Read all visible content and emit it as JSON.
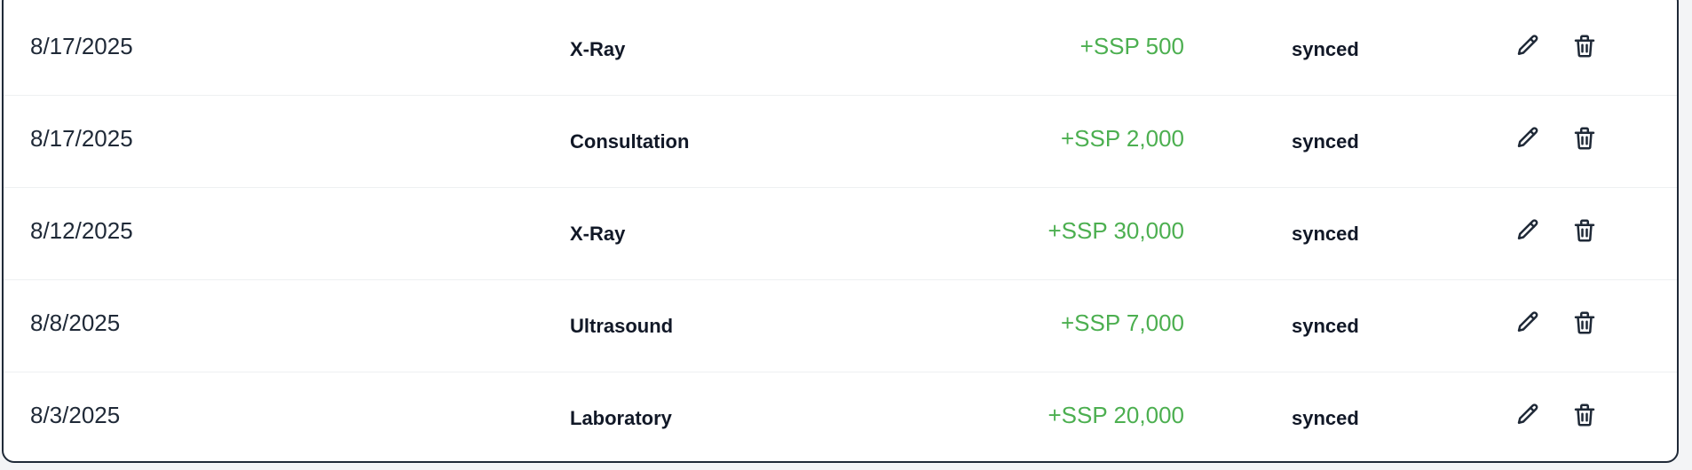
{
  "transactions": [
    {
      "date": "8/17/2025",
      "category": "X-Ray",
      "amount": "+SSP 500",
      "status": "synced"
    },
    {
      "date": "8/17/2025",
      "category": "Consultation",
      "amount": "+SSP 2,000",
      "status": "synced"
    },
    {
      "date": "8/12/2025",
      "category": "X-Ray",
      "amount": "+SSP 30,000",
      "status": "synced"
    },
    {
      "date": "8/8/2025",
      "category": "Ultrasound",
      "amount": "+SSP 7,000",
      "status": "synced"
    },
    {
      "date": "8/3/2025",
      "category": "Laboratory",
      "amount": "+SSP 20,000",
      "status": "synced"
    }
  ],
  "icons": {
    "edit": "pencil-icon",
    "delete": "trash-icon"
  },
  "colors": {
    "amount_positive": "#4caf50",
    "text": "#111827",
    "border": "#1f2937"
  }
}
